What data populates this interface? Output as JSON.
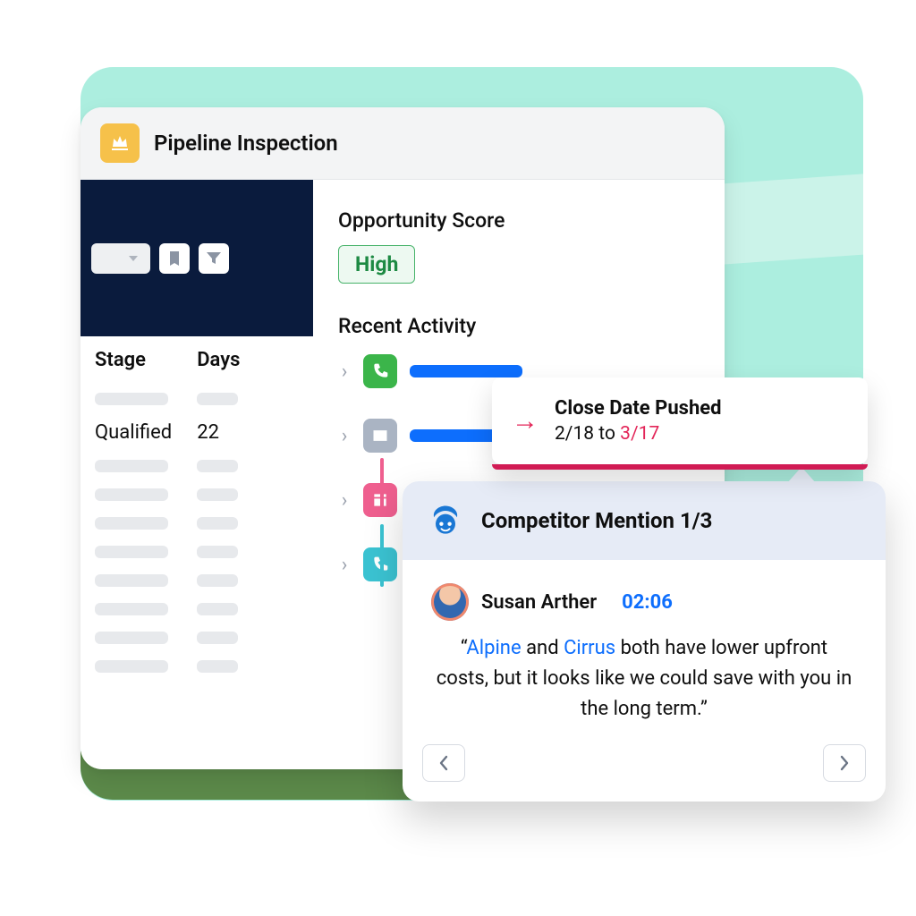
{
  "app": {
    "title": "Pipeline Inspection"
  },
  "table": {
    "headers": {
      "stage": "Stage",
      "days": "Days"
    },
    "row": {
      "stage": "Qualified",
      "days": "22"
    }
  },
  "score": {
    "label": "Opportunity Score",
    "value": "High"
  },
  "recent": {
    "label": "Recent Activity"
  },
  "popup": {
    "title": "Close Date Pushed",
    "from": "2/18",
    "to_word": "to",
    "to": "3/17"
  },
  "mention": {
    "title": "Competitor Mention 1/3",
    "author": "Susan Arther",
    "time": "02:06",
    "q_open": "“",
    "hl1": "Alpine",
    "mid1": " and ",
    "hl2": "Cirrus",
    "rest": " both have lower upfront costs, but it looks like we could save with you in the long term.”"
  }
}
